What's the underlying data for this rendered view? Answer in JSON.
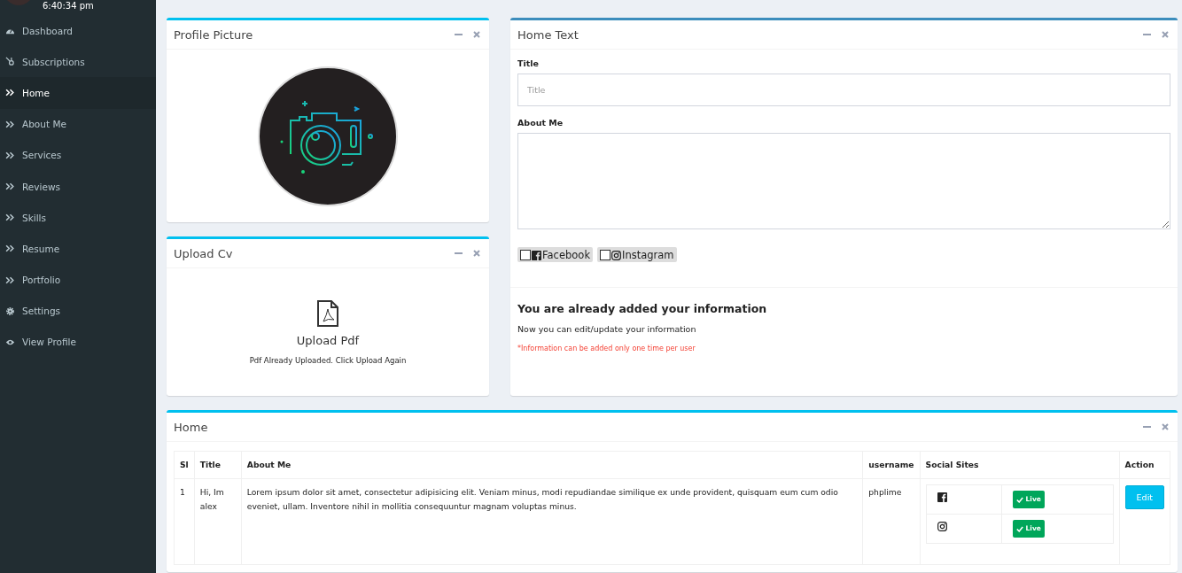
{
  "sidebar": {
    "time": "6:40:34 pm",
    "items": [
      {
        "label": "Dashboard",
        "kind": "dashboard",
        "selected": false
      },
      {
        "label": "Subscriptions",
        "kind": "hub",
        "selected": false
      },
      {
        "label": "Home",
        "kind": "page",
        "selected": true
      },
      {
        "label": "About Me",
        "kind": "page",
        "selected": false
      },
      {
        "label": "Services",
        "kind": "page",
        "selected": false
      },
      {
        "label": "Reviews",
        "kind": "page",
        "selected": false
      },
      {
        "label": "Skills",
        "kind": "page",
        "selected": false
      },
      {
        "label": "Resume",
        "kind": "page",
        "selected": false
      },
      {
        "label": "Portfolio",
        "kind": "page",
        "selected": false
      },
      {
        "label": "Settings",
        "kind": "settings",
        "selected": false
      },
      {
        "label": "View Profile",
        "kind": "profile",
        "selected": false
      }
    ]
  },
  "profile_picture": {
    "title": "Profile Picture"
  },
  "upload_cv": {
    "title": "Upload Cv",
    "button": "Upload Pdf",
    "note": "Pdf Already Uploaded. Click Upload Again"
  },
  "home_text": {
    "title": "Home Text",
    "title_label": "Title",
    "title_placeholder": "Title",
    "about_label": "About Me",
    "socials": [
      {
        "kind": "facebook",
        "label": "Facebook",
        "checked": false
      },
      {
        "kind": "instagram",
        "label": "Instagram",
        "checked": false
      }
    ],
    "heading": "You are already added your information",
    "message": "Now you can edit/update your information",
    "warning": "*Information can be added only one time per user"
  },
  "home_table": {
    "title": "Home",
    "columns": [
      "Sl",
      "Title",
      "About Me",
      "username",
      "Social Sites",
      "Action"
    ],
    "rows": [
      {
        "sl": "1",
        "title": "Hi, Im alex",
        "about": "Lorem ipsum dolor sit amet, consectetur adipisicing elit. Veniam minus, modi repudiandae similique ex unde provident, quisquam eum cum odio eveniet, ullam. Inventore nihil in mollitia consequuntur magnam voluptas minus.",
        "username": "phplime",
        "socials": [
          {
            "kind": "facebook",
            "status": "Live"
          },
          {
            "kind": "instagram",
            "status": "Live"
          }
        ],
        "action": "Edit"
      }
    ]
  }
}
